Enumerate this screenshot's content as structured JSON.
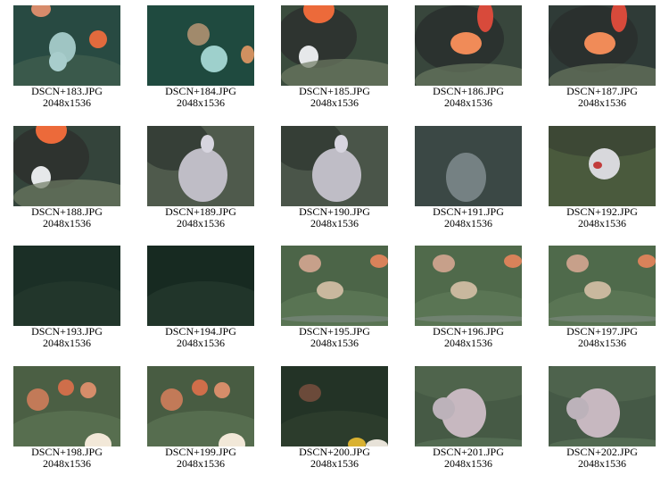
{
  "gallery": {
    "items": [
      {
        "name": "DSCN+183.JPG",
        "dims": "2048x1536",
        "scene": "octopus-anemone",
        "bg": "#284a42"
      },
      {
        "name": "DSCN+184.JPG",
        "dims": "2048x1536",
        "scene": "octopus-dark",
        "bg": "#1f4a3f"
      },
      {
        "name": "DSCN+185.JPG",
        "dims": "2048x1536",
        "scene": "rock-octopus",
        "bg": "#3a4c3d"
      },
      {
        "name": "DSCN+186.JPG",
        "dims": "2048x1536",
        "scene": "rock-anemone",
        "bg": "#38463c"
      },
      {
        "name": "DSCN+187.JPG",
        "dims": "2048x1536",
        "scene": "rock-anemone",
        "bg": "#2f3b37"
      },
      {
        "name": "DSCN+188.JPG",
        "dims": "2048x1536",
        "scene": "rock-octopus",
        "bg": "#34443b"
      },
      {
        "name": "DSCN+189.JPG",
        "dims": "2048x1536",
        "scene": "octopus-big",
        "bg": "#4f5a4c"
      },
      {
        "name": "DSCN+190.JPG",
        "dims": "2048x1536",
        "scene": "octopus-big",
        "bg": "#4a5549"
      },
      {
        "name": "DSCN+191.JPG",
        "dims": "2048x1536",
        "scene": "octopus-faint",
        "bg": "#3b4845"
      },
      {
        "name": "DSCN+192.JPG",
        "dims": "2048x1536",
        "scene": "octopus-rock",
        "bg": "#4a5a3d"
      },
      {
        "name": "DSCN+193.JPG",
        "dims": "2048x1536",
        "scene": "seafloor-dark",
        "bg": "#1b2f26"
      },
      {
        "name": "DSCN+194.JPG",
        "dims": "2048x1536",
        "scene": "seafloor-dark",
        "bg": "#172a21"
      },
      {
        "name": "DSCN+195.JPG",
        "dims": "2048x1536",
        "scene": "stalks",
        "bg": "#4c6548"
      },
      {
        "name": "DSCN+196.JPG",
        "dims": "2048x1536",
        "scene": "stalks",
        "bg": "#506a4b"
      },
      {
        "name": "DSCN+197.JPG",
        "dims": "2048x1536",
        "scene": "stalks",
        "bg": "#4f6a4b"
      },
      {
        "name": "DSCN+198.JPG",
        "dims": "2048x1536",
        "scene": "stalks-warm",
        "bg": "#4b5f44"
      },
      {
        "name": "DSCN+199.JPG",
        "dims": "2048x1536",
        "scene": "stalks-warm",
        "bg": "#485c42"
      },
      {
        "name": "DSCN+200.JPG",
        "dims": "2048x1536",
        "scene": "stalks-dark",
        "bg": "#233326"
      },
      {
        "name": "DSCN+201.JPG",
        "dims": "2048x1536",
        "scene": "octopus-curl",
        "bg": "#465a45"
      },
      {
        "name": "DSCN+202.JPG",
        "dims": "2048x1536",
        "scene": "octopus-curl",
        "bg": "#455946"
      }
    ]
  }
}
